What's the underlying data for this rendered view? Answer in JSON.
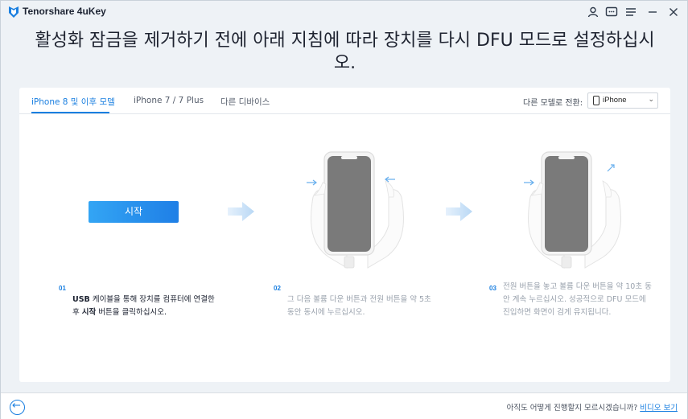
{
  "app": {
    "title": "Tenorshare 4uKey"
  },
  "heading": "활성화 잠금을 제거하기 전에 아래 지침에 따라 장치를 다시 DFU 모드로 설정하십시오.",
  "tabs": [
    {
      "label": "iPhone 8 및 이후 모델",
      "active": true
    },
    {
      "label": "iPhone 7 / 7 Plus",
      "active": false
    },
    {
      "label": "다른 디바이스",
      "active": false
    }
  ],
  "model_switch": {
    "label": "다른 모델로 전환:",
    "value": "iPhone"
  },
  "start_button": "시작",
  "steps": [
    {
      "num": "01",
      "strong1": "USB",
      "text1": " 케이블을 통해 장치를 컴퓨터에 연결한 후 ",
      "strong2": "시작",
      "text2": " 버튼을 클릭하십시오."
    },
    {
      "num": "02",
      "text": "그 다음 볼륨 다운 버튼과 전원 버튼을 약 5초 동안 동시에 누르십시오."
    },
    {
      "num": "03",
      "text": "전원 버튼을 놓고 볼륨 다운 버튼을 약 10초 동안 계속 누르십시오. 성공적으로 DFU 모드에 진입하면 화면이 검게 유지됩니다."
    }
  ],
  "footer": {
    "question": "아직도 어떻게 진행할지 모르시겠습니까? ",
    "link": "비디오 보기"
  },
  "colors": {
    "accent": "#1a7fe0",
    "phone_screen": "#7a7a7a"
  }
}
